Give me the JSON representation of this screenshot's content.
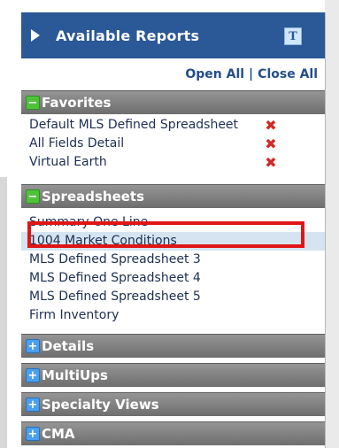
{
  "panel": {
    "title": "Available Reports",
    "title_icon_label": "T",
    "open_all": "Open All",
    "separator": "|",
    "close_all": "Close All"
  },
  "sections": {
    "favorites": {
      "title": "Favorites",
      "toggle": "−",
      "items": [
        {
          "label": "Default MLS Defined Spreadsheet",
          "remove": "✖"
        },
        {
          "label": "All Fields Detail",
          "remove": "✖"
        },
        {
          "label": "Virtual Earth",
          "remove": "✖"
        }
      ]
    },
    "spreadsheets": {
      "title": "Spreadsheets",
      "toggle": "−",
      "items": [
        "Summary One Line",
        "1004 Market Conditions",
        "MLS Defined Spreadsheet 3",
        "MLS Defined Spreadsheet 4",
        "MLS Defined Spreadsheet 5",
        "Firm Inventory"
      ],
      "highlighted_item": "1004 Market Conditions"
    },
    "details": {
      "title": "Details",
      "toggle": "+"
    },
    "multiups": {
      "title": "MultiUps",
      "toggle": "+"
    },
    "specialty_views": {
      "title": "Specialty Views",
      "toggle": "+"
    },
    "cma": {
      "title": "CMA",
      "toggle": "+"
    }
  },
  "colors": {
    "title_bar": "#2b5897",
    "section_header": "#7a7a7a",
    "toggle_collapse": "#4ec33a",
    "toggle_expand": "#4aa0f0",
    "remove_icon": "#d22a24",
    "highlight_border": "#e01515",
    "selected_row": "#d5e4f0"
  },
  "icons": {
    "title_arrow": "triangle-right-icon",
    "title_badge": "t-icon",
    "remove": "red-x-icon",
    "collapse": "minus-square-icon",
    "expand": "plus-square-icon"
  }
}
